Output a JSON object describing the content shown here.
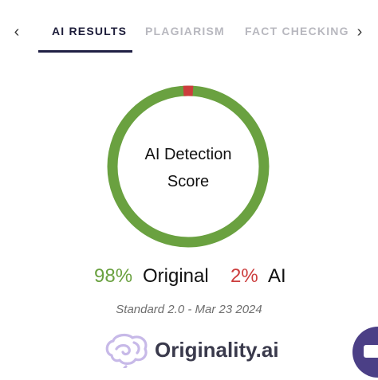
{
  "tabs": {
    "prev_icon": "chevron-left-icon",
    "next_icon": "chevron-right-icon",
    "items": [
      {
        "label": "AI RESULTS",
        "active": true
      },
      {
        "label": "PLAGIARISM",
        "active": false
      },
      {
        "label": "FACT CHECKING",
        "active": false
      }
    ]
  },
  "score": {
    "ring_line1": "AI Detection",
    "ring_line2": "Score",
    "original_fraction": 0.98,
    "ai_fraction": 0.02,
    "original_percent": "98%",
    "original_label": "Original",
    "ai_percent": "2%",
    "ai_label": "AI",
    "colors": {
      "original": "#6aa140",
      "ai": "#cc3d3d"
    }
  },
  "meta": {
    "model_date": "Standard 2.0 - Mar 23 2024"
  },
  "brand": {
    "name": "Originality.ai",
    "logo_icon": "brain-logo-icon"
  },
  "chat": {
    "icon": "chat-bubble-icon",
    "color": "#4b3f86"
  }
}
